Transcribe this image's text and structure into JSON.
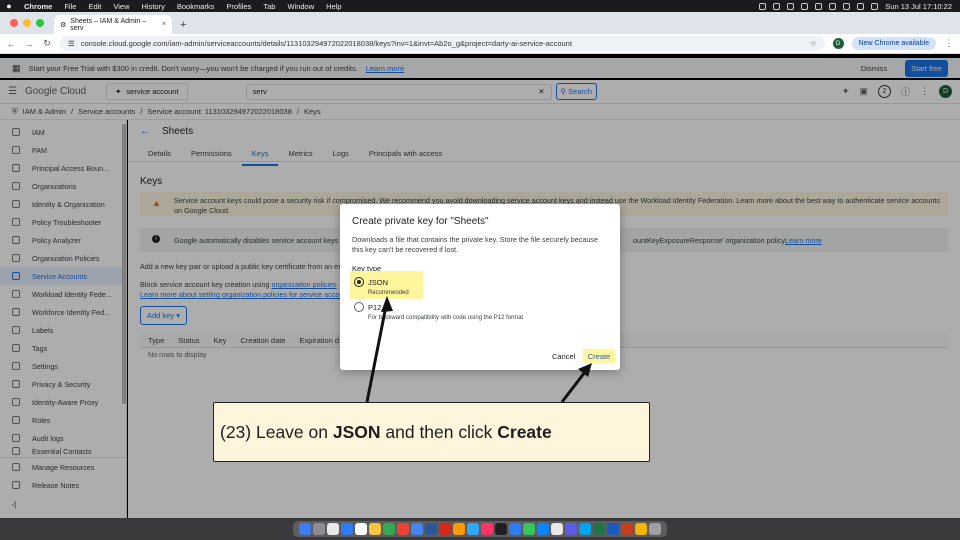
{
  "menubar": {
    "app": "Chrome",
    "items": [
      "File",
      "Edit",
      "View",
      "History",
      "Bookmarks",
      "Profiles",
      "Tab",
      "Window",
      "Help"
    ],
    "clock": "Sun 13 Jul  17:10:22"
  },
  "browser": {
    "tab_title": "Sheets – IAM & Admin – serv",
    "url": "console.cloud.google.com/iam-admin/serviceaccounts/details/113103294972022018038/keys?inv=1&invt=Ab2o_g&project=darty-ai-service-account",
    "profile_initial": "D",
    "new_chrome": "New Chrome available"
  },
  "trial": {
    "text": "Start your Free Trial with $300 in credit. Don't worry—you won't be charged if you run out of credits.",
    "link": "Learn more",
    "dismiss": "Dismiss",
    "start": "Start free"
  },
  "header": {
    "logo": "Google Cloud",
    "project": "service account",
    "search_value": "serv",
    "search_btn": "Search",
    "notif_count": "2",
    "avatar": "D"
  },
  "breadcrumb": [
    "IAM & Admin",
    "Service accounts",
    "Service account: 113103294972022018038",
    "Keys"
  ],
  "sidebar": {
    "items": [
      {
        "label": "IAM",
        "active": false
      },
      {
        "label": "PAM",
        "active": false
      },
      {
        "label": "Principal Access Boun...",
        "active": false
      },
      {
        "label": "Organizations",
        "active": false
      },
      {
        "label": "Identity & Organization",
        "active": false
      },
      {
        "label": "Policy Troubleshooter",
        "active": false
      },
      {
        "label": "Policy Analyzer",
        "active": false
      },
      {
        "label": "Organization Policies",
        "active": false
      },
      {
        "label": "Service Accounts",
        "active": true
      },
      {
        "label": "Workload Identity Fede...",
        "active": false
      },
      {
        "label": "Workforce Identity Fed...",
        "active": false
      },
      {
        "label": "Labels",
        "active": false
      },
      {
        "label": "Tags",
        "active": false
      },
      {
        "label": "Settings",
        "active": false
      },
      {
        "label": "Privacy & Security",
        "active": false
      },
      {
        "label": "Identity-Aware Proxy",
        "active": false
      },
      {
        "label": "Roles",
        "active": false
      },
      {
        "label": "Audit logs",
        "active": false
      },
      {
        "label": "Essential Contacts",
        "active": false
      }
    ],
    "bottom": [
      "Manage Resources",
      "Release Notes"
    ]
  },
  "main": {
    "title": "Sheets",
    "tabs": [
      "Details",
      "Permissions",
      "Keys",
      "Metrics",
      "Logs",
      "Principals with access"
    ],
    "active_tab": "Keys",
    "heading": "Keys",
    "warning": "Service account keys could pose a security risk if compromised. We recommend you avoid downloading service account keys and instead use the Workload Identity Federation. Learn more about the best way to authenticate service accounts on Google Cloud.",
    "info": "Google automatically disables service account keys d",
    "info_tail": "ountKeyExposureResponse' organization policy.",
    "info_link": "Learn more",
    "add_text": "Add a new key pair or upload a public key certificate from an exis",
    "block_text": "Block service account key creation using",
    "block_link": "organization policies",
    "learn_link": "Learn more about setting organization policies for service accounts",
    "add_key": "Add key",
    "columns": [
      "Type",
      "Status",
      "Key",
      "Creation date",
      "Expiration d"
    ],
    "empty": "No rows to display"
  },
  "dialog": {
    "title": "Create private key for \"Sheets\"",
    "desc": "Downloads a file that contains the private key. Store the file securely because this key can't be recovered if lost.",
    "key_type": "Key type",
    "opt1": "JSON",
    "opt1_sub": "Recommended",
    "opt2": "P12",
    "opt2_sub": "For backward compatibility with code using the P12 format",
    "cancel": "Cancel",
    "create": "Create"
  },
  "annotation": {
    "prefix": "(23) Leave on ",
    "b1": "JSON",
    "mid": " and then click ",
    "b2": "Create"
  }
}
